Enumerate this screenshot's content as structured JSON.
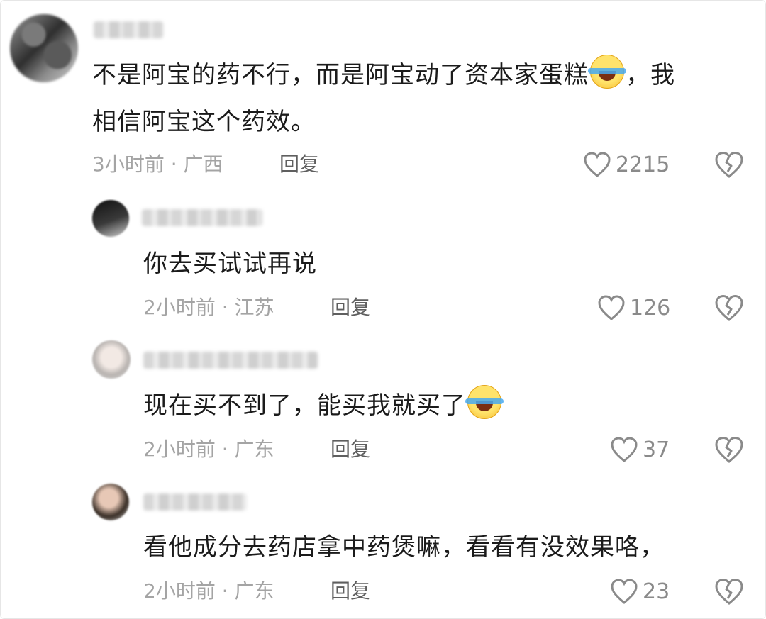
{
  "comments": [
    {
      "text_lines": [
        "不是阿宝的药不行，而是阿宝动了资本家蛋糕",
        "，我",
        "相信阿宝这个药效。"
      ],
      "emoji": "laughing-crying-emoji",
      "time_location": "3小时前 · 广西",
      "reply_label": "回复",
      "likes": "2215"
    },
    {
      "text": "你去买试试再说",
      "time_location": "2小时前 · 江苏",
      "reply_label": "回复",
      "likes": "126"
    },
    {
      "text": "现在买不到了，能买我就买了",
      "emoji": "laughing-crying-emoji",
      "time_location": "2小时前 · 广东",
      "reply_label": "回复",
      "likes": "37"
    },
    {
      "text": "看他成分去药店拿中药煲嘛，看看有没效果咯，",
      "time_location": "2小时前 · 广东",
      "reply_label": "回复",
      "likes": "23"
    }
  ],
  "colors": {
    "meta": "#a4a4a4",
    "reply": "#5f5f5f",
    "like": "#8a8a8a",
    "text": "#1b1b1b"
  }
}
